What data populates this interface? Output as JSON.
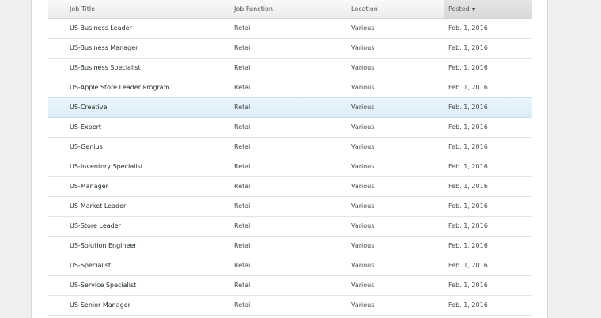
{
  "table": {
    "columns": {
      "title": "Job Title",
      "function": "Job Function",
      "location": "Location",
      "posted": "Posted"
    },
    "sort_icon": "▼",
    "rows": [
      {
        "title": "US-Business Leader",
        "function": "Retail",
        "location": "Various",
        "posted": "Feb. 1, 2016"
      },
      {
        "title": "US-Business Manager",
        "function": "Retail",
        "location": "Various",
        "posted": "Feb. 1, 2016"
      },
      {
        "title": "US-Business Specialist",
        "function": "Retail",
        "location": "Various",
        "posted": "Feb. 1, 2016"
      },
      {
        "title": "US-Apple Store Leader Program",
        "function": "Retail",
        "location": "Various",
        "posted": "Feb. 1, 2016"
      },
      {
        "title": "US-Creative",
        "function": "Retail",
        "location": "Various",
        "posted": "Feb. 1, 2016"
      },
      {
        "title": "US-Expert",
        "function": "Retail",
        "location": "Various",
        "posted": "Feb. 1, 2016"
      },
      {
        "title": "US-Genius",
        "function": "Retail",
        "location": "Various",
        "posted": "Feb. 1, 2016"
      },
      {
        "title": "US-Inventory Specialist",
        "function": "Retail",
        "location": "Various",
        "posted": "Feb. 1, 2016"
      },
      {
        "title": "US-Manager",
        "function": "Retail",
        "location": "Various",
        "posted": "Feb. 1, 2016"
      },
      {
        "title": "US-Market Leader",
        "function": "Retail",
        "location": "Various",
        "posted": "Feb. 1, 2016"
      },
      {
        "title": "US-Store Leader",
        "function": "Retail",
        "location": "Various",
        "posted": "Feb. 1, 2016"
      },
      {
        "title": "US-Solution Engineer",
        "function": "Retail",
        "location": "Various",
        "posted": "Feb. 1, 2016"
      },
      {
        "title": "US-Specialist",
        "function": "Retail",
        "location": "Various",
        "posted": "Feb. 1, 2016"
      },
      {
        "title": "US-Service Specialist",
        "function": "Retail",
        "location": "Various",
        "posted": "Feb. 1, 2016"
      },
      {
        "title": "US-Senior Manager",
        "function": "Retail",
        "location": "Various",
        "posted": "Feb. 1, 2016"
      }
    ]
  }
}
